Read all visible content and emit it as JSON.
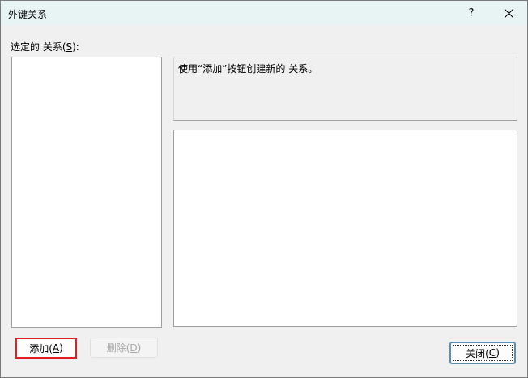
{
  "window": {
    "title": "外键关系",
    "help_label": "?",
    "close_glyph": "✕"
  },
  "relationships": {
    "label_prefix": "选定的 关系(",
    "label_mnemonic": "S",
    "label_suffix": "):",
    "items": []
  },
  "description": {
    "text": "使用“添加”按钮创建新的 关系。"
  },
  "buttons": {
    "add_prefix": "添加(",
    "add_mnemonic": "A",
    "add_suffix": ")",
    "delete_prefix": "删除(",
    "delete_mnemonic": "D",
    "delete_suffix": ")",
    "close_prefix": "关闭(",
    "close_mnemonic": "C",
    "close_suffix": ")"
  },
  "colors": {
    "titlebar": "#e8f4f4",
    "dialog_bg": "#f0f0f0",
    "highlight_border": "#e02020",
    "default_button_border": "#5b8fb0"
  }
}
